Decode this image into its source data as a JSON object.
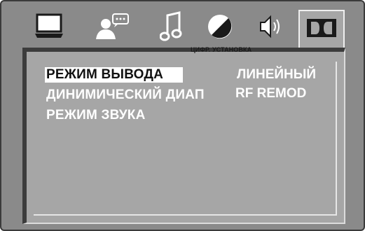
{
  "tabs": [
    {
      "icon": "monitor-icon",
      "active": false
    },
    {
      "icon": "user-chat-icon",
      "active": false
    },
    {
      "icon": "music-note-icon",
      "active": false
    },
    {
      "icon": "contrast-circle-icon",
      "active": false
    },
    {
      "icon": "speaker-icon",
      "active": false
    },
    {
      "icon": "dolby-digital-icon",
      "active": true
    }
  ],
  "tab_caption": "ЦИФР. УСТАНОВКА",
  "menu": [
    {
      "label": "РЕЖИМ ВЫВОДА",
      "value": "ЛИНЕЙНЫЙ",
      "selected": true
    },
    {
      "label": "ДИНИМИЧЕСКИЙ  ДИАП",
      "value": "RF REMOD",
      "selected": false
    },
    {
      "label": "РЕЖИМ ЗВУКА",
      "value": "",
      "selected": false
    }
  ],
  "colors": {
    "background": "#8a8a8a",
    "panel": "#a6a6a6",
    "text": "#ffffff",
    "highlight": "#ffffff",
    "icon_dark": "#1a1a1a"
  }
}
